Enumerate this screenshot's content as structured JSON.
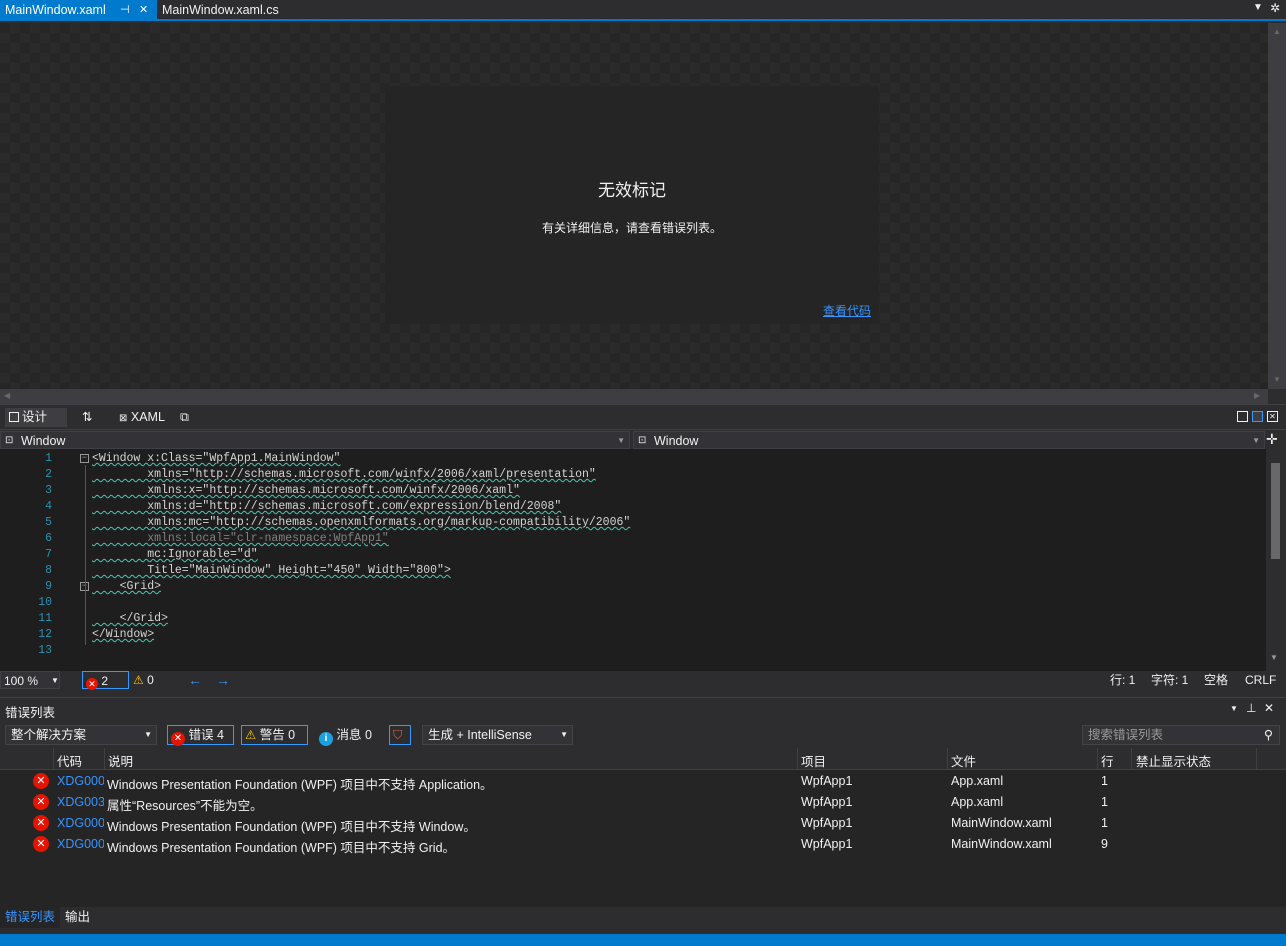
{
  "tabs": [
    {
      "label": "MainWindow.xaml",
      "active": true
    },
    {
      "label": "MainWindow.xaml.cs",
      "active": false
    }
  ],
  "designer": {
    "error_title": "无效标记",
    "error_message": "有关详细信息，请查看错误列表。",
    "view_code_link": "查看代码"
  },
  "split_bar": {
    "design_label": "设计",
    "xaml_label": "XAML"
  },
  "nav_bar": {
    "left_dropdown": "Window",
    "right_dropdown": "Window"
  },
  "editor": {
    "line_numbers": [
      "1",
      "2",
      "3",
      "4",
      "5",
      "6",
      "7",
      "8",
      "9",
      "10",
      "11",
      "12",
      "13"
    ],
    "lines": [
      "<Window x:Class=\"WpfApp1.MainWindow\"",
      "        xmlns=\"http://schemas.microsoft.com/winfx/2006/xaml/presentation\"",
      "        xmlns:x=\"http://schemas.microsoft.com/winfx/2006/xaml\"",
      "        xmlns:d=\"http://schemas.microsoft.com/expression/blend/2008\"",
      "        xmlns:mc=\"http://schemas.openxmlformats.org/markup-compatibility/2006\"",
      "        xmlns:local=\"clr-namespace:WpfApp1\"",
      "        mc:Ignorable=\"d\"",
      "        Title=\"MainWindow\" Height=\"450\" Width=\"800\">",
      "    <Grid>",
      "",
      "    </Grid>",
      "</Window>",
      ""
    ]
  },
  "editor_status": {
    "zoom": "100 %",
    "error_count": "2",
    "warning_count": "0",
    "row": "行: 1",
    "char": "字符: 1",
    "whitespace": "空格",
    "line_ending": "CRLF"
  },
  "error_list": {
    "title": "错误列表",
    "scope": "整个解决方案",
    "errors_btn": "错误 4",
    "warnings_btn": "警告 0",
    "messages_btn": "消息 0",
    "build_filter": "生成 + IntelliSense",
    "search_placeholder": "搜索错误列表",
    "columns": [
      "代码",
      "说明",
      "项目",
      "文件",
      "行",
      "禁止显示状态"
    ],
    "rows": [
      {
        "code": "XDG000",
        "desc": "Windows Presentation Foundation (WPF) 项目中不支持 Application。",
        "project": "WpfApp1",
        "file": "App.xaml",
        "line": "1"
      },
      {
        "code": "XDG003",
        "desc": "属性“Resources”不能为空。",
        "project": "WpfApp1",
        "file": "App.xaml",
        "line": "1"
      },
      {
        "code": "XDG000",
        "desc": "Windows Presentation Foundation (WPF) 项目中不支持 Window。",
        "project": "WpfApp1",
        "file": "MainWindow.xaml",
        "line": "1"
      },
      {
        "code": "XDG000",
        "desc": "Windows Presentation Foundation (WPF) 项目中不支持 Grid。",
        "project": "WpfApp1",
        "file": "MainWindow.xaml",
        "line": "9"
      }
    ]
  },
  "bottom_tabs": [
    {
      "label": "错误列表",
      "active": true
    },
    {
      "label": "输出",
      "active": false
    }
  ],
  "colors": {
    "accent": "#007acc",
    "error": "#e51400",
    "link": "#3794ff"
  }
}
